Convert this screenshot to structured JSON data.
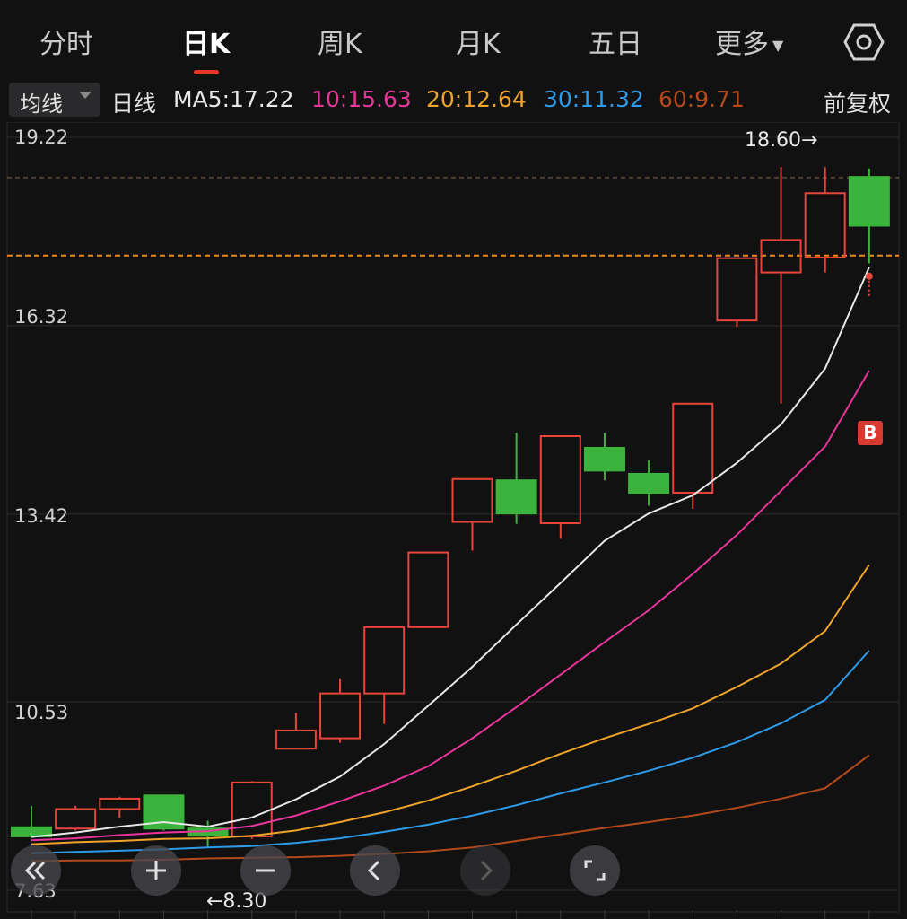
{
  "tabs": [
    {
      "label": "分时"
    },
    {
      "label": "日K"
    },
    {
      "label": "周K"
    },
    {
      "label": "月K"
    },
    {
      "label": "五日"
    },
    {
      "label": "更多"
    }
  ],
  "active_tab": "日K",
  "ma_bar": {
    "selector_label": "均线",
    "period_label": "日线",
    "ma5": {
      "text": "MA5:17.22",
      "color": "#e8e8e8"
    },
    "ma10": {
      "text": "10:15.63",
      "color": "#e8359b"
    },
    "ma20": {
      "text": "20:12.64",
      "color": "#f0a32a"
    },
    "ma30": {
      "text": "30:11.32",
      "color": "#2f9ae8"
    },
    "ma60": {
      "text": "60:9.71",
      "color": "#b34a1c"
    },
    "adjust_label": "前复权"
  },
  "chart_data": {
    "type": "candlestick",
    "y_tick_labels": [
      "19.22",
      "16.32",
      "13.42",
      "10.53",
      "7.63"
    ],
    "ylim": [
      7.63,
      19.22
    ],
    "max_annotation": "18.60→",
    "min_annotation": "←8.30",
    "buy_marker": "B",
    "reference_lines": [
      18.6,
      17.4
    ],
    "colors": {
      "up": "#e8443a",
      "down": "#3cb33c",
      "grid": "#2c2c2e"
    },
    "candles": [
      {
        "open": 8.6,
        "close": 8.46,
        "high": 8.93,
        "low": 8.46
      },
      {
        "open": 8.58,
        "close": 8.88,
        "high": 8.93,
        "low": 8.55
      },
      {
        "open": 8.88,
        "close": 9.04,
        "high": 9.07,
        "low": 8.74
      },
      {
        "open": 9.09,
        "close": 8.58,
        "high": 9.09,
        "low": 8.55
      },
      {
        "open": 8.58,
        "close": 8.47,
        "high": 8.7,
        "low": 8.3
      },
      {
        "open": 8.46,
        "close": 9.29,
        "high": 9.31,
        "low": 8.42
      },
      {
        "open": 9.81,
        "close": 10.09,
        "high": 10.36,
        "low": 9.81
      },
      {
        "open": 9.97,
        "close": 10.66,
        "high": 10.88,
        "low": 9.9
      },
      {
        "open": 10.66,
        "close": 11.68,
        "high": 11.68,
        "low": 10.19
      },
      {
        "open": 11.68,
        "close": 12.83,
        "high": 12.83,
        "low": 11.68
      },
      {
        "open": 13.3,
        "close": 13.96,
        "high": 13.96,
        "low": 12.86
      },
      {
        "open": 13.94,
        "close": 13.43,
        "high": 14.67,
        "low": 13.27
      },
      {
        "open": 13.28,
        "close": 14.62,
        "high": 14.62,
        "low": 13.04
      },
      {
        "open": 14.44,
        "close": 14.09,
        "high": 14.67,
        "low": 13.94
      },
      {
        "open": 14.04,
        "close": 13.75,
        "high": 14.25,
        "low": 13.55
      },
      {
        "open": 13.75,
        "close": 15.12,
        "high": 15.12,
        "low": 13.5
      },
      {
        "open": 16.4,
        "close": 17.36,
        "high": 17.36,
        "low": 16.3
      },
      {
        "open": 17.14,
        "close": 17.64,
        "high": 18.76,
        "low": 15.12
      },
      {
        "open": 17.37,
        "close": 18.36,
        "high": 18.76,
        "low": 17.14
      },
      {
        "open": 18.61,
        "close": 17.86,
        "high": 18.74,
        "low": 17.28
      }
    ],
    "ma_series": [
      {
        "name": "MA5",
        "color": "#e8e8e8",
        "values": [
          8.45,
          8.52,
          8.61,
          8.68,
          8.61,
          8.75,
          9.03,
          9.38,
          9.88,
          10.47,
          11.07,
          11.72,
          12.36,
          13.01,
          13.43,
          13.71,
          14.21,
          14.8,
          15.66,
          17.22
        ]
      },
      {
        "name": "10",
        "color": "#e8359b",
        "values": [
          8.4,
          8.43,
          8.48,
          8.52,
          8.54,
          8.62,
          8.78,
          9.0,
          9.24,
          9.54,
          9.97,
          10.45,
          10.95,
          11.45,
          11.94,
          12.5,
          13.1,
          13.78,
          14.46,
          15.63
        ]
      },
      {
        "name": "20",
        "color": "#f0a32a",
        "values": [
          8.34,
          8.37,
          8.39,
          8.42,
          8.43,
          8.47,
          8.55,
          8.68,
          8.83,
          9.01,
          9.23,
          9.47,
          9.73,
          9.97,
          10.19,
          10.43,
          10.76,
          11.12,
          11.62,
          12.64
        ]
      },
      {
        "name": "30",
        "color": "#2f9ae8",
        "values": [
          8.2,
          8.22,
          8.24,
          8.26,
          8.29,
          8.31,
          8.36,
          8.43,
          8.53,
          8.64,
          8.78,
          8.94,
          9.12,
          9.29,
          9.47,
          9.67,
          9.91,
          10.2,
          10.56,
          11.32
        ]
      },
      {
        "name": "60",
        "color": "#b34a1c",
        "values": [
          8.08,
          8.09,
          8.09,
          8.1,
          8.12,
          8.13,
          8.14,
          8.16,
          8.19,
          8.23,
          8.29,
          8.39,
          8.49,
          8.59,
          8.68,
          8.78,
          8.9,
          9.04,
          9.2,
          9.71
        ]
      }
    ]
  },
  "controls": [
    {
      "icon": "double-left-icon"
    },
    {
      "icon": "zoom-in-icon"
    },
    {
      "icon": "zoom-out-icon"
    },
    {
      "icon": "chevron-left-icon"
    },
    {
      "icon": "chevron-right-icon"
    },
    {
      "icon": "fullscreen-icon"
    }
  ]
}
